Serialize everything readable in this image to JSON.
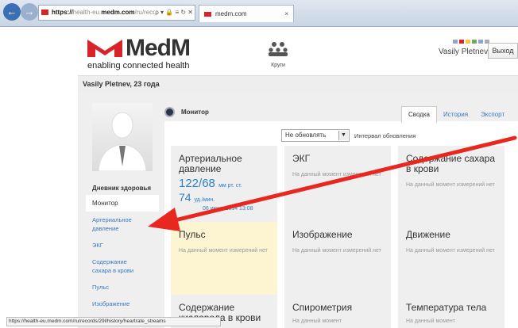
{
  "browser": {
    "url": {
      "scheme": "https://",
      "host_prefix": "health-eu.",
      "host": "medm.com",
      "path": "/ru/records/29l",
      "icons": "ρ ▾ 🔒 ≡ ↻ ✕"
    },
    "tab_title": "medm.com",
    "tab_close": "×",
    "back": "←",
    "forward": "→"
  },
  "header": {
    "brand": "MedM",
    "tagline": "enabling connected health",
    "circles_label": "Круги",
    "user_name": "Vasily Pletnev",
    "logout": "Выход"
  },
  "patient_title": "Vasily Pletnev, 23 года",
  "sidebar": {
    "title": "Дневник здоровья",
    "items": [
      {
        "label": "Монитор"
      },
      {
        "label": "Артериальное давление"
      },
      {
        "label": "ЭКГ"
      },
      {
        "label": "Содержание сахара в крови"
      },
      {
        "label": "Пульс"
      },
      {
        "label": "Изображение"
      }
    ]
  },
  "monitor": {
    "title": "Монитор",
    "tabs": [
      {
        "label": "Сводка"
      },
      {
        "label": "История"
      },
      {
        "label": "Экспорт"
      }
    ],
    "refresh_select": "Не обновлять",
    "interval_label": "Интервал обновления",
    "no_data": "На данный момент измерений нет",
    "no_data_cut": "На данный момент",
    "cards": {
      "bp": {
        "title": "Артериальное давление",
        "value": "122/68",
        "unit": "мм рт. ст.",
        "pulse": "74",
        "pulse_unit": "уд./мин.",
        "date": "06 июня 2014 13:08"
      },
      "ecg": {
        "title": "ЭКГ"
      },
      "glucose": {
        "title": "Содержание сахара в крови"
      },
      "pulse": {
        "title": "Пульс"
      },
      "image": {
        "title": "Изображение"
      },
      "motion": {
        "title": "Движение"
      },
      "oxygen": {
        "title": "Содержание кислорода в крови"
      },
      "spiro": {
        "title": "Спирометрия"
      },
      "temp": {
        "title": "Температура тела"
      }
    }
  },
  "status_url": "https://health-eu.medm.com/ru/records/29l/history/heartrate_streams",
  "colors": {
    "accent": "#3a79bf",
    "brand_red": "#d8232a",
    "highlight_card": "#fdf4d2",
    "arrow": "#e8281e"
  }
}
